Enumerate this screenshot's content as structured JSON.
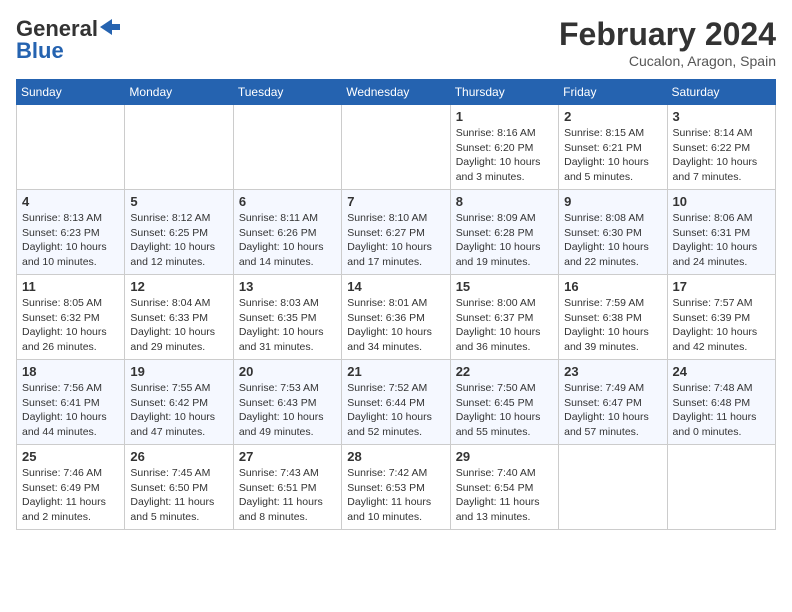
{
  "logo": {
    "line1": "General",
    "line2": "Blue"
  },
  "title": "February 2024",
  "subtitle": "Cucalon, Aragon, Spain",
  "days_of_week": [
    "Sunday",
    "Monday",
    "Tuesday",
    "Wednesday",
    "Thursday",
    "Friday",
    "Saturday"
  ],
  "weeks": [
    [
      {
        "num": "",
        "info": ""
      },
      {
        "num": "",
        "info": ""
      },
      {
        "num": "",
        "info": ""
      },
      {
        "num": "",
        "info": ""
      },
      {
        "num": "1",
        "info": "Sunrise: 8:16 AM\nSunset: 6:20 PM\nDaylight: 10 hours\nand 3 minutes."
      },
      {
        "num": "2",
        "info": "Sunrise: 8:15 AM\nSunset: 6:21 PM\nDaylight: 10 hours\nand 5 minutes."
      },
      {
        "num": "3",
        "info": "Sunrise: 8:14 AM\nSunset: 6:22 PM\nDaylight: 10 hours\nand 7 minutes."
      }
    ],
    [
      {
        "num": "4",
        "info": "Sunrise: 8:13 AM\nSunset: 6:23 PM\nDaylight: 10 hours\nand 10 minutes."
      },
      {
        "num": "5",
        "info": "Sunrise: 8:12 AM\nSunset: 6:25 PM\nDaylight: 10 hours\nand 12 minutes."
      },
      {
        "num": "6",
        "info": "Sunrise: 8:11 AM\nSunset: 6:26 PM\nDaylight: 10 hours\nand 14 minutes."
      },
      {
        "num": "7",
        "info": "Sunrise: 8:10 AM\nSunset: 6:27 PM\nDaylight: 10 hours\nand 17 minutes."
      },
      {
        "num": "8",
        "info": "Sunrise: 8:09 AM\nSunset: 6:28 PM\nDaylight: 10 hours\nand 19 minutes."
      },
      {
        "num": "9",
        "info": "Sunrise: 8:08 AM\nSunset: 6:30 PM\nDaylight: 10 hours\nand 22 minutes."
      },
      {
        "num": "10",
        "info": "Sunrise: 8:06 AM\nSunset: 6:31 PM\nDaylight: 10 hours\nand 24 minutes."
      }
    ],
    [
      {
        "num": "11",
        "info": "Sunrise: 8:05 AM\nSunset: 6:32 PM\nDaylight: 10 hours\nand 26 minutes."
      },
      {
        "num": "12",
        "info": "Sunrise: 8:04 AM\nSunset: 6:33 PM\nDaylight: 10 hours\nand 29 minutes."
      },
      {
        "num": "13",
        "info": "Sunrise: 8:03 AM\nSunset: 6:35 PM\nDaylight: 10 hours\nand 31 minutes."
      },
      {
        "num": "14",
        "info": "Sunrise: 8:01 AM\nSunset: 6:36 PM\nDaylight: 10 hours\nand 34 minutes."
      },
      {
        "num": "15",
        "info": "Sunrise: 8:00 AM\nSunset: 6:37 PM\nDaylight: 10 hours\nand 36 minutes."
      },
      {
        "num": "16",
        "info": "Sunrise: 7:59 AM\nSunset: 6:38 PM\nDaylight: 10 hours\nand 39 minutes."
      },
      {
        "num": "17",
        "info": "Sunrise: 7:57 AM\nSunset: 6:39 PM\nDaylight: 10 hours\nand 42 minutes."
      }
    ],
    [
      {
        "num": "18",
        "info": "Sunrise: 7:56 AM\nSunset: 6:41 PM\nDaylight: 10 hours\nand 44 minutes."
      },
      {
        "num": "19",
        "info": "Sunrise: 7:55 AM\nSunset: 6:42 PM\nDaylight: 10 hours\nand 47 minutes."
      },
      {
        "num": "20",
        "info": "Sunrise: 7:53 AM\nSunset: 6:43 PM\nDaylight: 10 hours\nand 49 minutes."
      },
      {
        "num": "21",
        "info": "Sunrise: 7:52 AM\nSunset: 6:44 PM\nDaylight: 10 hours\nand 52 minutes."
      },
      {
        "num": "22",
        "info": "Sunrise: 7:50 AM\nSunset: 6:45 PM\nDaylight: 10 hours\nand 55 minutes."
      },
      {
        "num": "23",
        "info": "Sunrise: 7:49 AM\nSunset: 6:47 PM\nDaylight: 10 hours\nand 57 minutes."
      },
      {
        "num": "24",
        "info": "Sunrise: 7:48 AM\nSunset: 6:48 PM\nDaylight: 11 hours\nand 0 minutes."
      }
    ],
    [
      {
        "num": "25",
        "info": "Sunrise: 7:46 AM\nSunset: 6:49 PM\nDaylight: 11 hours\nand 2 minutes."
      },
      {
        "num": "26",
        "info": "Sunrise: 7:45 AM\nSunset: 6:50 PM\nDaylight: 11 hours\nand 5 minutes."
      },
      {
        "num": "27",
        "info": "Sunrise: 7:43 AM\nSunset: 6:51 PM\nDaylight: 11 hours\nand 8 minutes."
      },
      {
        "num": "28",
        "info": "Sunrise: 7:42 AM\nSunset: 6:53 PM\nDaylight: 11 hours\nand 10 minutes."
      },
      {
        "num": "29",
        "info": "Sunrise: 7:40 AM\nSunset: 6:54 PM\nDaylight: 11 hours\nand 13 minutes."
      },
      {
        "num": "",
        "info": ""
      },
      {
        "num": "",
        "info": ""
      }
    ]
  ]
}
